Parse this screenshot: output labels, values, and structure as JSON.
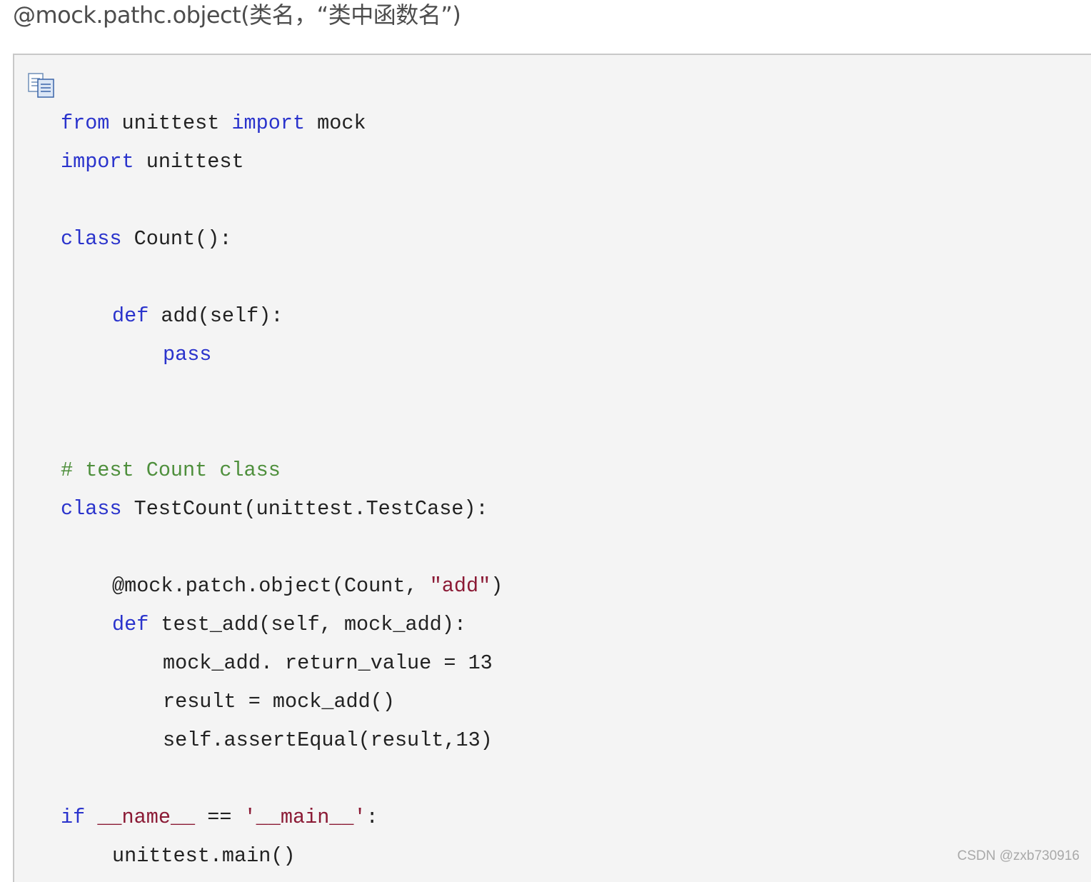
{
  "heading": "@mock.pathc.object(类名，“类中函数名”)",
  "code_block": {
    "copy_icon": "copy-icon",
    "lines": [
      {
        "tokens": [
          {
            "t": "from",
            "c": "kw"
          },
          {
            "t": " unittest ",
            "c": "plain"
          },
          {
            "t": "import",
            "c": "kw"
          },
          {
            "t": " mock",
            "c": "plain"
          }
        ]
      },
      {
        "tokens": [
          {
            "t": "import",
            "c": "kw"
          },
          {
            "t": " unittest",
            "c": "plain"
          }
        ]
      },
      {
        "tokens": [
          {
            "t": "class",
            "c": "kw"
          },
          {
            "t": " Count():",
            "c": "plain"
          }
        ]
      },
      {
        "tokens": [
          {
            "t": "def",
            "c": "kw"
          },
          {
            "t": " add(self):",
            "c": "plain"
          }
        ]
      },
      {
        "tokens": [
          {
            "t": "pass",
            "c": "kw"
          }
        ]
      },
      {
        "tokens": [
          {
            "t": "# test Count class",
            "c": "cm"
          }
        ]
      },
      {
        "tokens": [
          {
            "t": "class",
            "c": "kw"
          },
          {
            "t": " TestCount(unittest.TestCase):",
            "c": "plain"
          }
        ]
      },
      {
        "tokens": [
          {
            "t": "@mock.patch.object(Count, ",
            "c": "plain"
          },
          {
            "t": "\"add\"",
            "c": "st"
          },
          {
            "t": ")",
            "c": "plain"
          }
        ]
      },
      {
        "tokens": [
          {
            "t": "def",
            "c": "kw"
          },
          {
            "t": " test_add(self, mock_add):",
            "c": "plain"
          }
        ]
      },
      {
        "tokens": [
          {
            "t": "mock_add. return_value = 13",
            "c": "plain"
          }
        ]
      },
      {
        "tokens": [
          {
            "t": "result = mock_add()",
            "c": "plain"
          }
        ]
      },
      {
        "tokens": [
          {
            "t": "self.assertEqual(result,13)",
            "c": "plain"
          }
        ]
      },
      {
        "tokens": [
          {
            "t": "if",
            "c": "kw"
          },
          {
            "t": " ",
            "c": "plain"
          },
          {
            "t": "__name__",
            "c": "st"
          },
          {
            "t": " == ",
            "c": "plain"
          },
          {
            "t": "'__main__'",
            "c": "st"
          },
          {
            "t": ":",
            "c": "plain"
          }
        ]
      },
      {
        "tokens": [
          {
            "t": "unittest.main()",
            "c": "plain"
          }
        ]
      }
    ]
  },
  "watermark": "CSDN @zxb730916"
}
